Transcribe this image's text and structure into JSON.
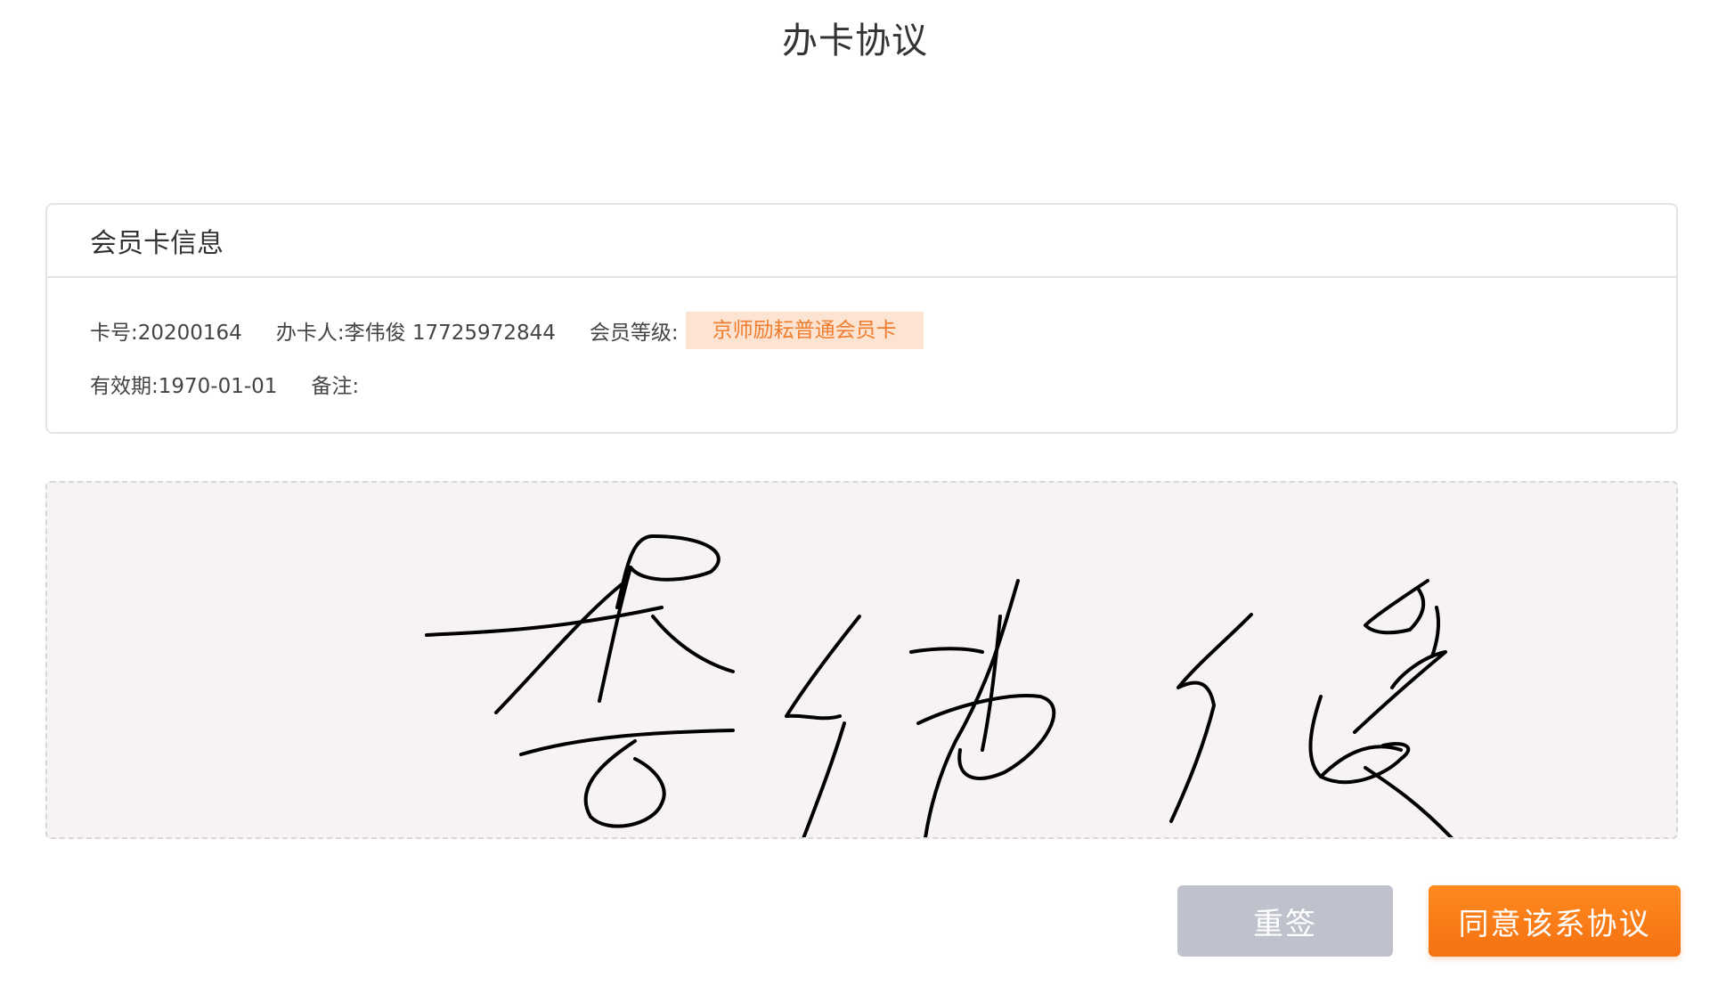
{
  "header": {
    "title": "办卡协议"
  },
  "card_info": {
    "section_title": "会员卡信息",
    "card_number": "卡号:20200164",
    "applicant": "办卡人:李伟俊 17725972844",
    "level_label": "会员等级:",
    "level_value": "京师励耘普通会员卡",
    "validity": "有效期:1970-01-01",
    "remark": "备注:"
  },
  "signature": {
    "signed_name": "李伟俊",
    "ink_color": "#000000",
    "pad_background": "#f7f3f5"
  },
  "actions": {
    "resign_label": "重签",
    "agree_label": "同意该系协议"
  },
  "colors": {
    "accent": "#f57112",
    "badge_bg": "#fde4d2",
    "badge_text": "#f07d2e",
    "disabled_button": "#bfc2cc"
  }
}
